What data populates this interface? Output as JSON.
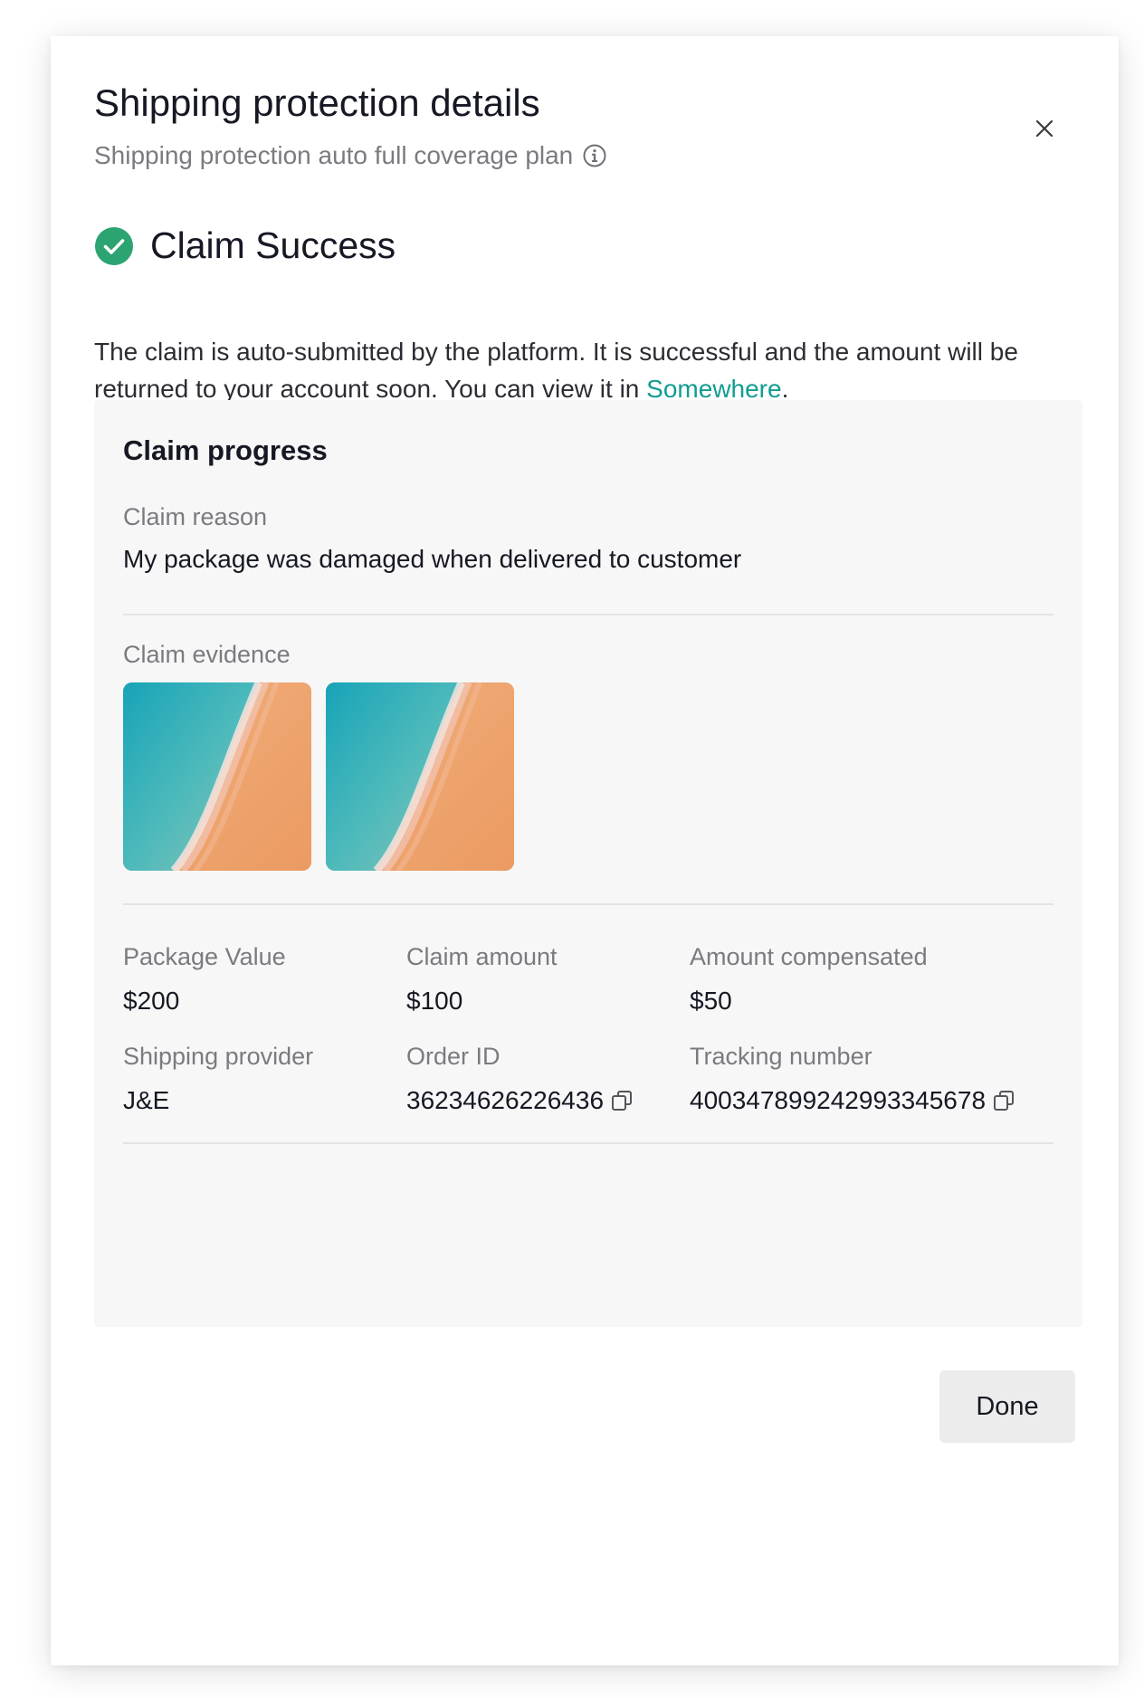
{
  "modal": {
    "title": "Shipping protection details",
    "subtitle": "Shipping protection auto full coverage plan"
  },
  "status": {
    "title": "Claim Success",
    "description_prefix": "The claim is auto-submitted by the platform. It is successful and the amount will be returned to your account soon. You can view it in ",
    "link_text": "Somewhere",
    "description_suffix": ".",
    "success_color": "#2ba471",
    "link_color": "#119d93"
  },
  "progress": {
    "title": "Claim progress",
    "reason_label": "Claim reason",
    "reason_value": "My package was damaged when delivered to customer",
    "evidence_label": "Claim evidence",
    "evidence_images": [
      {
        "name": "evidence-image-1"
      },
      {
        "name": "evidence-image-2"
      }
    ],
    "fields": {
      "package_value_label": "Package Value",
      "package_value": "$200",
      "claim_amount_label": "Claim amount",
      "claim_amount": "$100",
      "amount_compensated_label": "Amount compensated",
      "amount_compensated": "$50",
      "shipping_provider_label": "Shipping provider",
      "shipping_provider": "J&E",
      "order_id_label": "Order ID",
      "order_id": "36234626226436",
      "tracking_number_label": "Tracking number",
      "tracking_number": "400347899242993345678"
    }
  },
  "footer": {
    "done_label": "Done"
  },
  "icons": {
    "close": "close-icon",
    "info": "info-icon",
    "success": "check-circle-icon",
    "copy": "copy-icon"
  }
}
